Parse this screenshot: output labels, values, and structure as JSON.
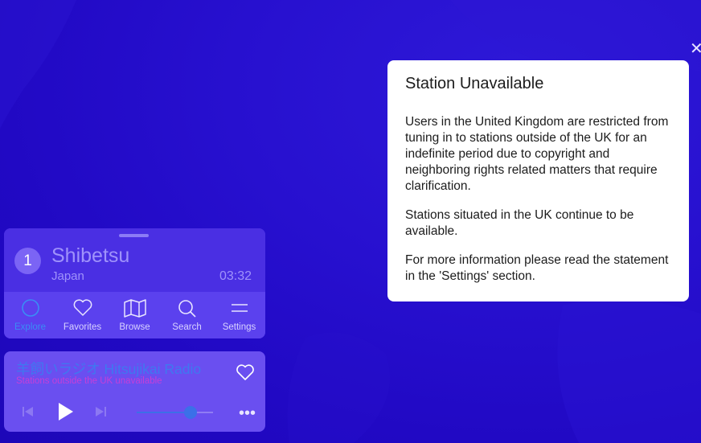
{
  "colors": {
    "background": "#2310c8",
    "accent": "#3a8df5",
    "subtitle_magenta": "#c63fd8",
    "modal_bg": "#ffffff"
  },
  "close_icon": "close-icon",
  "current_station": {
    "rank": "1",
    "name": "Shibetsu",
    "country": "Japan",
    "time": "03:32"
  },
  "nav": [
    {
      "label": "Explore",
      "icon": "explore-circle-icon",
      "active": true
    },
    {
      "label": "Favorites",
      "icon": "heart-icon",
      "active": false
    },
    {
      "label": "Browse",
      "icon": "map-icon",
      "active": false
    },
    {
      "label": "Search",
      "icon": "search-icon",
      "active": false
    },
    {
      "label": "Settings",
      "icon": "menu-lines-icon",
      "active": false
    }
  ],
  "now_playing": {
    "title": "羊飼いラジオ Hitsujikai Radio",
    "subtitle": "Stations outside the UK unavailable",
    "volume": 0.7
  },
  "modal": {
    "title": "Station Unavailable",
    "paragraphs": [
      "Users in the United Kingdom are restricted from tuning in to stations outside of the UK for an indefinite period due to copyright and neighboring rights related matters that require clarification.",
      "Stations situated in the UK continue to be available.",
      "For more information please read the statement in the 'Settings' section."
    ]
  }
}
